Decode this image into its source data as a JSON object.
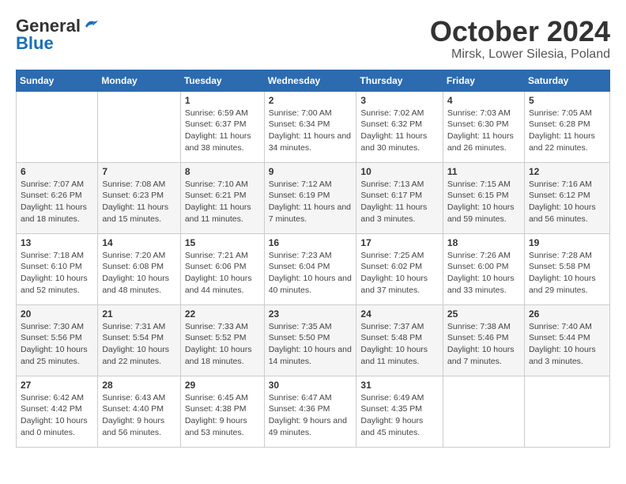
{
  "header": {
    "logo_line1": "General",
    "logo_line2": "Blue",
    "month": "October 2024",
    "location": "Mirsk, Lower Silesia, Poland"
  },
  "days_of_week": [
    "Sunday",
    "Monday",
    "Tuesday",
    "Wednesday",
    "Thursday",
    "Friday",
    "Saturday"
  ],
  "weeks": [
    [
      {
        "day": "",
        "info": ""
      },
      {
        "day": "",
        "info": ""
      },
      {
        "day": "1",
        "info": "Sunrise: 6:59 AM\nSunset: 6:37 PM\nDaylight: 11 hours and 38 minutes."
      },
      {
        "day": "2",
        "info": "Sunrise: 7:00 AM\nSunset: 6:34 PM\nDaylight: 11 hours and 34 minutes."
      },
      {
        "day": "3",
        "info": "Sunrise: 7:02 AM\nSunset: 6:32 PM\nDaylight: 11 hours and 30 minutes."
      },
      {
        "day": "4",
        "info": "Sunrise: 7:03 AM\nSunset: 6:30 PM\nDaylight: 11 hours and 26 minutes."
      },
      {
        "day": "5",
        "info": "Sunrise: 7:05 AM\nSunset: 6:28 PM\nDaylight: 11 hours and 22 minutes."
      }
    ],
    [
      {
        "day": "6",
        "info": "Sunrise: 7:07 AM\nSunset: 6:26 PM\nDaylight: 11 hours and 18 minutes."
      },
      {
        "day": "7",
        "info": "Sunrise: 7:08 AM\nSunset: 6:23 PM\nDaylight: 11 hours and 15 minutes."
      },
      {
        "day": "8",
        "info": "Sunrise: 7:10 AM\nSunset: 6:21 PM\nDaylight: 11 hours and 11 minutes."
      },
      {
        "day": "9",
        "info": "Sunrise: 7:12 AM\nSunset: 6:19 PM\nDaylight: 11 hours and 7 minutes."
      },
      {
        "day": "10",
        "info": "Sunrise: 7:13 AM\nSunset: 6:17 PM\nDaylight: 11 hours and 3 minutes."
      },
      {
        "day": "11",
        "info": "Sunrise: 7:15 AM\nSunset: 6:15 PM\nDaylight: 10 hours and 59 minutes."
      },
      {
        "day": "12",
        "info": "Sunrise: 7:16 AM\nSunset: 6:12 PM\nDaylight: 10 hours and 56 minutes."
      }
    ],
    [
      {
        "day": "13",
        "info": "Sunrise: 7:18 AM\nSunset: 6:10 PM\nDaylight: 10 hours and 52 minutes."
      },
      {
        "day": "14",
        "info": "Sunrise: 7:20 AM\nSunset: 6:08 PM\nDaylight: 10 hours and 48 minutes."
      },
      {
        "day": "15",
        "info": "Sunrise: 7:21 AM\nSunset: 6:06 PM\nDaylight: 10 hours and 44 minutes."
      },
      {
        "day": "16",
        "info": "Sunrise: 7:23 AM\nSunset: 6:04 PM\nDaylight: 10 hours and 40 minutes."
      },
      {
        "day": "17",
        "info": "Sunrise: 7:25 AM\nSunset: 6:02 PM\nDaylight: 10 hours and 37 minutes."
      },
      {
        "day": "18",
        "info": "Sunrise: 7:26 AM\nSunset: 6:00 PM\nDaylight: 10 hours and 33 minutes."
      },
      {
        "day": "19",
        "info": "Sunrise: 7:28 AM\nSunset: 5:58 PM\nDaylight: 10 hours and 29 minutes."
      }
    ],
    [
      {
        "day": "20",
        "info": "Sunrise: 7:30 AM\nSunset: 5:56 PM\nDaylight: 10 hours and 25 minutes."
      },
      {
        "day": "21",
        "info": "Sunrise: 7:31 AM\nSunset: 5:54 PM\nDaylight: 10 hours and 22 minutes."
      },
      {
        "day": "22",
        "info": "Sunrise: 7:33 AM\nSunset: 5:52 PM\nDaylight: 10 hours and 18 minutes."
      },
      {
        "day": "23",
        "info": "Sunrise: 7:35 AM\nSunset: 5:50 PM\nDaylight: 10 hours and 14 minutes."
      },
      {
        "day": "24",
        "info": "Sunrise: 7:37 AM\nSunset: 5:48 PM\nDaylight: 10 hours and 11 minutes."
      },
      {
        "day": "25",
        "info": "Sunrise: 7:38 AM\nSunset: 5:46 PM\nDaylight: 10 hours and 7 minutes."
      },
      {
        "day": "26",
        "info": "Sunrise: 7:40 AM\nSunset: 5:44 PM\nDaylight: 10 hours and 3 minutes."
      }
    ],
    [
      {
        "day": "27",
        "info": "Sunrise: 6:42 AM\nSunset: 4:42 PM\nDaylight: 10 hours and 0 minutes."
      },
      {
        "day": "28",
        "info": "Sunrise: 6:43 AM\nSunset: 4:40 PM\nDaylight: 9 hours and 56 minutes."
      },
      {
        "day": "29",
        "info": "Sunrise: 6:45 AM\nSunset: 4:38 PM\nDaylight: 9 hours and 53 minutes."
      },
      {
        "day": "30",
        "info": "Sunrise: 6:47 AM\nSunset: 4:36 PM\nDaylight: 9 hours and 49 minutes."
      },
      {
        "day": "31",
        "info": "Sunrise: 6:49 AM\nSunset: 4:35 PM\nDaylight: 9 hours and 45 minutes."
      },
      {
        "day": "",
        "info": ""
      },
      {
        "day": "",
        "info": ""
      }
    ]
  ]
}
